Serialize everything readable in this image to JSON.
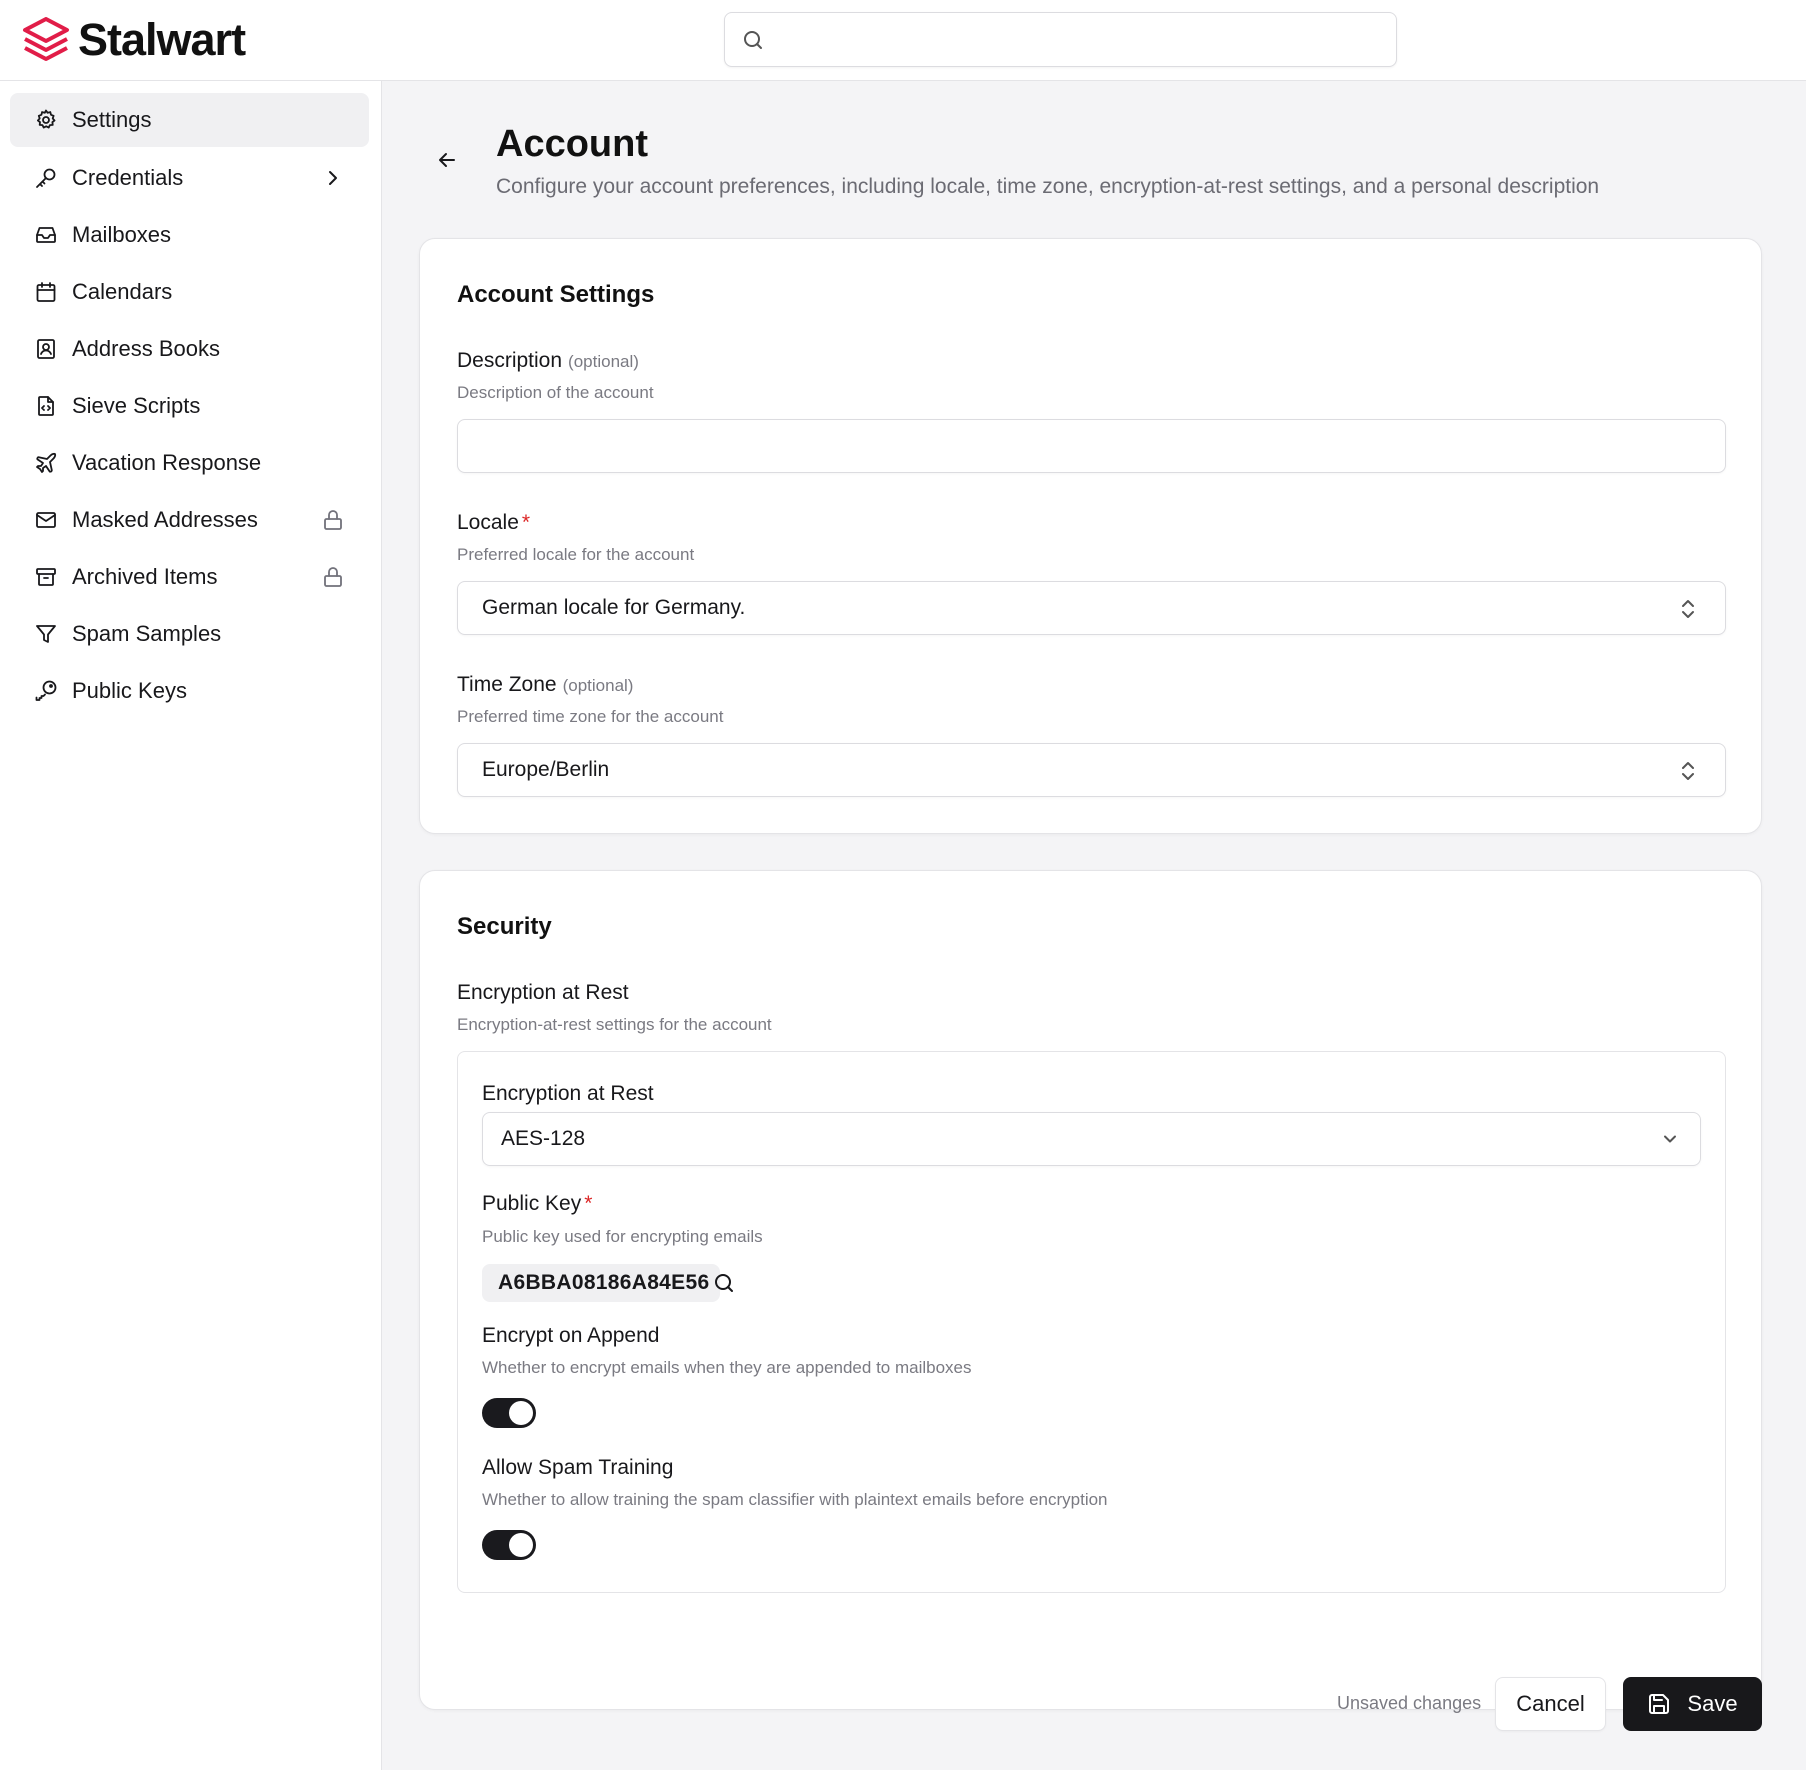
{
  "app": {
    "name": "Stalwart",
    "brand_color": "#e11d48"
  },
  "search": {
    "placeholder": "",
    "value": ""
  },
  "sidebar": {
    "items": [
      {
        "label": "Settings",
        "icon": "gear-icon",
        "active": true
      },
      {
        "label": "Credentials",
        "icon": "key-icon",
        "trailing": "chevron-right-icon"
      },
      {
        "label": "Mailboxes",
        "icon": "inbox-icon"
      },
      {
        "label": "Calendars",
        "icon": "calendar-icon"
      },
      {
        "label": "Address Books",
        "icon": "contact-book-icon"
      },
      {
        "label": "Sieve Scripts",
        "icon": "code-file-icon"
      },
      {
        "label": "Vacation Response",
        "icon": "plane-icon"
      },
      {
        "label": "Masked Addresses",
        "icon": "mail-icon",
        "trailing": "lock-icon"
      },
      {
        "label": "Archived Items",
        "icon": "archive-icon",
        "trailing": "lock-icon"
      },
      {
        "label": "Spam Samples",
        "icon": "filter-icon"
      },
      {
        "label": "Public Keys",
        "icon": "key-round-icon"
      }
    ]
  },
  "page": {
    "title": "Account",
    "subtitle": "Configure your account preferences, including locale, time zone, encryption-at-rest settings, and a personal description"
  },
  "account_settings": {
    "title": "Account Settings",
    "description": {
      "label": "Description",
      "optional": "(optional)",
      "hint": "Description of the account",
      "value": ""
    },
    "locale": {
      "label": "Locale",
      "required": "*",
      "hint": "Preferred locale for the account",
      "value": "German locale for Germany."
    },
    "timezone": {
      "label": "Time Zone",
      "optional": "(optional)",
      "hint": "Preferred time zone for the account",
      "value": "Europe/Berlin"
    }
  },
  "security": {
    "title": "Security",
    "encryption": {
      "label": "Encryption at Rest",
      "hint": "Encryption-at-rest settings for the account",
      "type_label": "Encryption at Rest",
      "type_value": "AES-128",
      "public_key_label": "Public Key",
      "public_key_required": "*",
      "public_key_hint": "Public key used for encrypting emails",
      "public_key_value": "A6BBA08186A84E56",
      "encrypt_on_append_label": "Encrypt on Append",
      "encrypt_on_append_hint": "Whether to encrypt emails when they are appended to mailboxes",
      "encrypt_on_append": true,
      "allow_spam_training_label": "Allow Spam Training",
      "allow_spam_training_hint": "Whether to allow training the spam classifier with plaintext emails before encryption",
      "allow_spam_training": true
    }
  },
  "footer": {
    "status": "Unsaved changes",
    "cancel_label": "Cancel",
    "save_label": "Save"
  }
}
